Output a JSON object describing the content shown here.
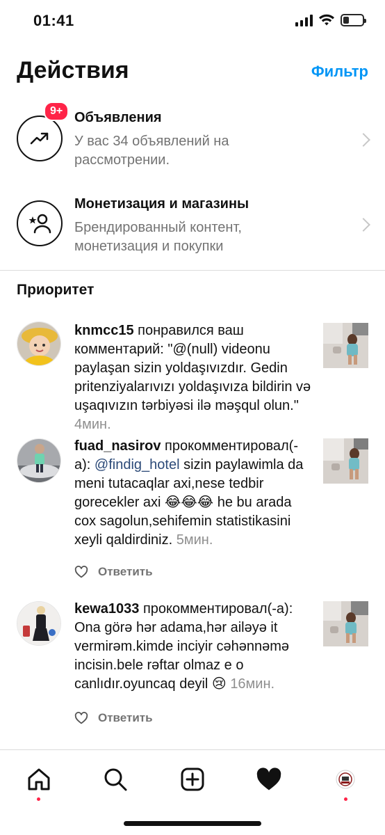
{
  "status_bar": {
    "time": "01:41"
  },
  "header": {
    "title": "Действия",
    "filter_label": "Фильтр"
  },
  "actions": [
    {
      "title": "Объявления",
      "subtitle": "У вас 34 объявлений на рассмотрении.",
      "badge": "9+",
      "icon": "trending-up-icon"
    },
    {
      "title": "Монетизация и магазины",
      "subtitle": "Брендированный контент, монетизация и покупки",
      "icon": "star-person-icon"
    }
  ],
  "priority_section": {
    "title": "Приоритет"
  },
  "notifications": [
    {
      "username": "knmcc15",
      "action": " понравился ваш комментарий: \"@(null) videonu paylaşan sizin yoldaşıvızdır. Gedin pritenziyalarıvızı yoldaşıvıza bildirin və uşaqıvızın tərbiyəsi ilə məşqul olun.\"",
      "time": "4мин."
    },
    {
      "username": "fuad_nasirov",
      "action_prefix": " прокомментировал(-а): ",
      "mention": "@findig_hotel",
      "action": " sizin paylawimla da meni tutacaqlar axi,nese tedbir gorecekler axi 😂😂😂 he bu arada cox sagolun,sehifemin statistikasini xeyli qaldirdiniz.",
      "time": "5мин.",
      "reply_label": "Ответить"
    },
    {
      "username": "kewa1033",
      "action": " прокомментировал(-а): Ona görə hər adama,hər ailəyə it vermirəm.kimde inciyir cəhənnəmə incisin.bele rəftar olmaz e o canlıdır.oyuncaq deyil 😢",
      "time": "16мин.",
      "reply_label": "Ответить"
    }
  ],
  "nav": [
    "home-icon",
    "search-icon",
    "create-icon",
    "activity-heart-icon",
    "profile-avatar-icon"
  ],
  "colors": {
    "accent": "#0095f6",
    "badge": "#ff2448",
    "secondary_text": "#737373"
  }
}
